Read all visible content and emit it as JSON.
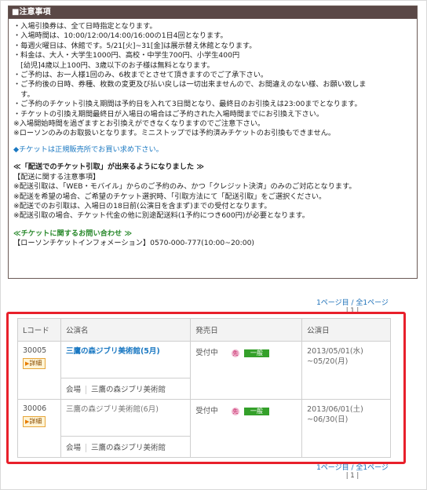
{
  "notice": {
    "title": "■注意事項",
    "lines": [
      "・入場引換券は、全て日時指定となります。",
      "・入場時間は、10:00/12:00/14:00/16:00の1日4回となります。",
      "・毎週火曜日は、休館です。5/21[火]~31[金]は展示替え休館となります。",
      "・料金は、大人・大学生1000円、高校・中学生700円、小学生400円",
      "　[幼児]4歳以上100円、3歳以下のお子様は無料となります。",
      "・ご予約は、お一人様1回のみ、6枚までとさせて頂きますのでご了承下さい。",
      "・ご予約後の日時、券種、枚数の変更及び払い戻しは一切出来ませんので、お間違えのない様、お願い致しま",
      "　す。",
      "・ご予約のチケット引換え期間は予約日を入れて3日間となり、最終日のお引換えは23:00までとなります。",
      "・チケットの引換え期間最終日が入場日の場合はご予約された入場時間までにお引換え下さい。",
      "※入場開始時間を過ぎますとお引換えができなくなりますのでご注意下さい。",
      "※ローソンのみのお取扱いとなります。ミニストップでは予約済みチケットのお引換もできません。"
    ],
    "link": "◆チケットは正規販売所でお買い求め下さい。",
    "delivery_heading": "≪「配送でのチケット引取」が出来るようになりました ≫",
    "delivery_lines": [
      "【配送に関する注意事項】",
      "※配送引取は、「WEB・モバイル」からのご予約のみ、かつ「クレジット決済」のみのご対応となります。",
      "※配送を希望の場合、ご希望のチケット選択時、「引取方法にて「配送引取」をご選択ください。",
      "※配送でのお引取は、入場日の18日前(公演日を含まず)までの受付となります。",
      "※配送引取の場合、チケット代金の他に別途配送料(1予約につき600円)が必要となります。"
    ],
    "inquiry_heading": "≪チケットに関するお問い合わせ ≫",
    "inquiry_line": "【ローソンチケットインフォメーション】0570-000-777(10:00~20:00)"
  },
  "pager": {
    "text": "1ページ目 / 全1ページ",
    "num": "| 1 |"
  },
  "table": {
    "headers": [
      "Lコード",
      "公演名",
      "発売日",
      "公演日"
    ],
    "detail_label": "詳細",
    "venue_label": "会場",
    "rows": [
      {
        "code": "30005",
        "title": "三鷹の森ジブリ美術館(5月)",
        "venue": "三鷹の森ジブリ美術館",
        "status": "受付中",
        "circle": "先",
        "badge": "一般",
        "date_from": "2013/05/01(水)",
        "date_to": "~05/20(月)"
      },
      {
        "code": "30006",
        "title": "三鷹の森ジブリ美術館(6月)",
        "venue": "三鷹の森ジブリ美術館",
        "status": "受付中",
        "circle": "先",
        "badge": "一般",
        "date_from": "2013/06/01(土)",
        "date_to": "~06/30(日)"
      }
    ]
  }
}
